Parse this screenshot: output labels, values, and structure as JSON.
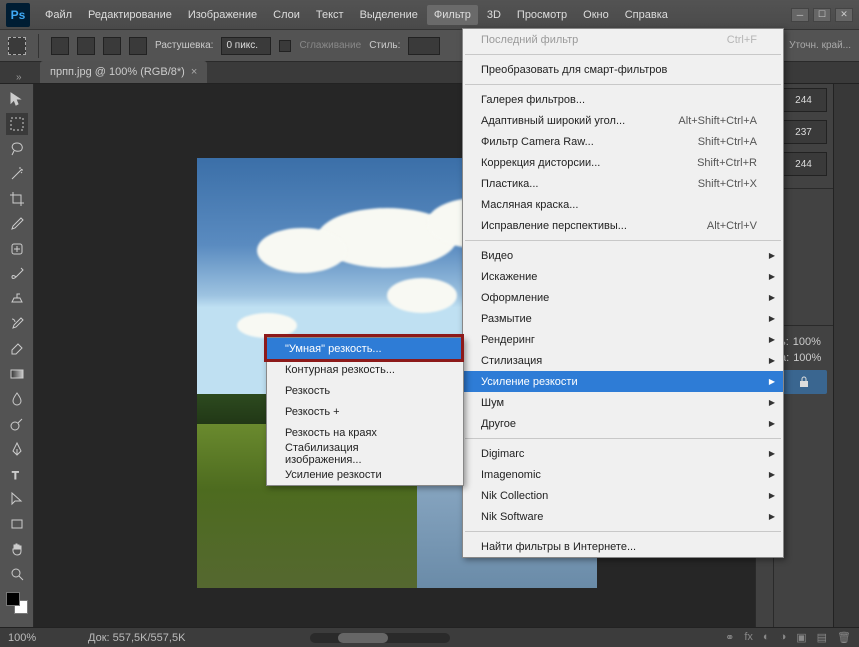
{
  "logo": "Ps",
  "menubar": [
    "Файл",
    "Редактирование",
    "Изображение",
    "Слои",
    "Текст",
    "Выделение",
    "Фильтр",
    "3D",
    "Просмотр",
    "Окно",
    "Справка"
  ],
  "active_menu_index": 6,
  "optionbar": {
    "feather_label": "Растушевка:",
    "feather_value": "0 пикс.",
    "antialias_label": "Сглаживание",
    "style_label": "Стиль:",
    "refine_label": "Уточн. край..."
  },
  "tab": {
    "title": "прпп.jpg @ 100% (RGB/8*)",
    "close": "×"
  },
  "panels": {
    "values": [
      "244",
      "237",
      "244"
    ],
    "pct1": "100%",
    "pct2": "100%"
  },
  "status": {
    "zoom": "100%",
    "doc_label": "Док:",
    "doc_value": "557,5K/557,5K"
  },
  "filter_menu": [
    {
      "label": "Последний фильтр",
      "shortcut": "Ctrl+F",
      "disabled": true
    },
    {
      "sep": true
    },
    {
      "label": "Преобразовать для смарт-фильтров"
    },
    {
      "sep": true
    },
    {
      "label": "Галерея фильтров..."
    },
    {
      "label": "Адаптивный широкий угол...",
      "shortcut": "Alt+Shift+Ctrl+A"
    },
    {
      "label": "Фильтр Camera Raw...",
      "shortcut": "Shift+Ctrl+A"
    },
    {
      "label": "Коррекция дисторсии...",
      "shortcut": "Shift+Ctrl+R"
    },
    {
      "label": "Пластика...",
      "shortcut": "Shift+Ctrl+X"
    },
    {
      "label": "Масляная краска..."
    },
    {
      "label": "Исправление перспективы...",
      "shortcut": "Alt+Ctrl+V"
    },
    {
      "sep": true
    },
    {
      "label": "Видео",
      "submenu": true
    },
    {
      "label": "Искажение",
      "submenu": true
    },
    {
      "label": "Оформление",
      "submenu": true
    },
    {
      "label": "Размытие",
      "submenu": true
    },
    {
      "label": "Рендеринг",
      "submenu": true
    },
    {
      "label": "Стилизация",
      "submenu": true
    },
    {
      "label": "Усиление резкости",
      "submenu": true,
      "highlight": true
    },
    {
      "label": "Шум",
      "submenu": true
    },
    {
      "label": "Другое",
      "submenu": true
    },
    {
      "sep": true
    },
    {
      "label": "Digimarc",
      "submenu": true
    },
    {
      "label": "Imagenomic",
      "submenu": true
    },
    {
      "label": "Nik Collection",
      "submenu": true
    },
    {
      "label": "Nik Software",
      "submenu": true
    },
    {
      "sep": true
    },
    {
      "label": "Найти фильтры в Интернете..."
    }
  ],
  "sharpen_submenu": [
    {
      "label": "\"Умная\" резкость...",
      "highlight": true
    },
    {
      "label": "Контурная резкость..."
    },
    {
      "label": "Резкость"
    },
    {
      "label": "Резкость +"
    },
    {
      "label": "Резкость на краях"
    },
    {
      "label": "Стабилизация изображения..."
    },
    {
      "label": "Усиление резкости"
    }
  ]
}
